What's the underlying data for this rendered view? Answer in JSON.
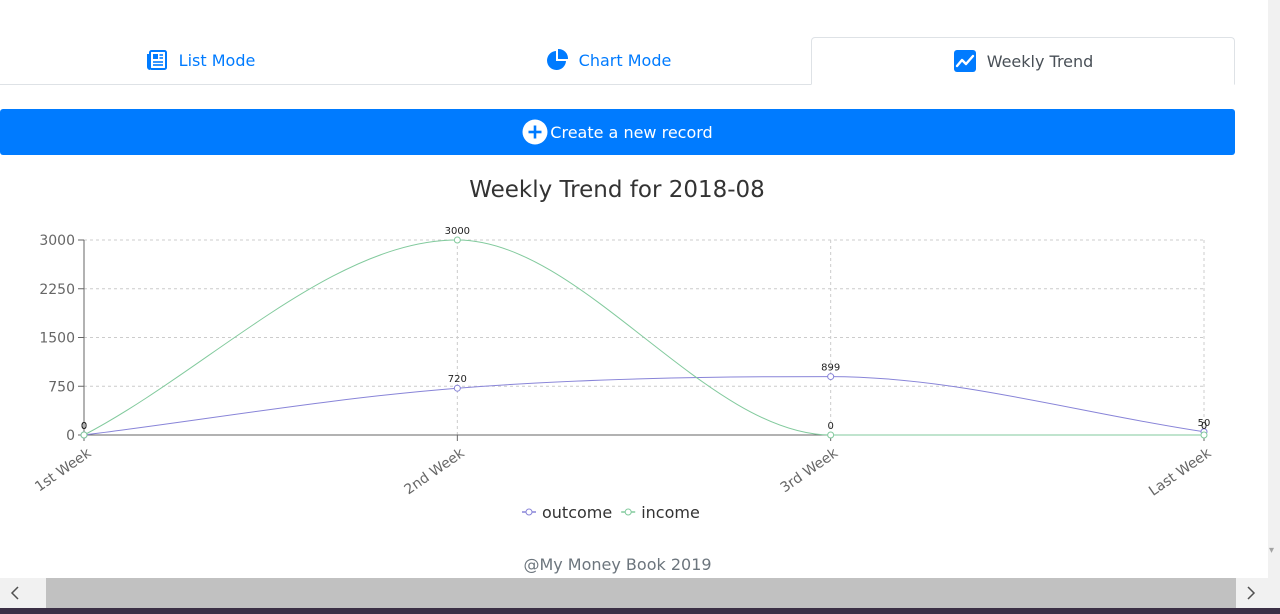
{
  "tabs": [
    {
      "label": "List Mode",
      "icon": "newspaper-icon"
    },
    {
      "label": "Chart Mode",
      "icon": "pie-chart-icon"
    },
    {
      "label": "Weekly Trend",
      "icon": "trend-line-icon",
      "active": true
    }
  ],
  "create_button": {
    "label": "Create a new record",
    "icon": "plus-circle-icon"
  },
  "colors": {
    "accent": "#007bff",
    "outcome": "#8884d8",
    "income": "#82ca9d"
  },
  "chart_data": {
    "type": "line",
    "title": "Weekly Trend for 2018-08",
    "categories": [
      "1st Week",
      "2nd Week",
      "3rd Week",
      "Last Week"
    ],
    "ylim": [
      0,
      3000
    ],
    "yticks": [
      0,
      750,
      1500,
      2250,
      3000
    ],
    "grid": true,
    "legend_position": "bottom",
    "series": [
      {
        "name": "outcome",
        "values": [
          0,
          720,
          899,
          50
        ]
      },
      {
        "name": "income",
        "values": [
          0,
          3000,
          0,
          0
        ]
      }
    ]
  },
  "footer": {
    "text": "@My Money Book 2019"
  }
}
